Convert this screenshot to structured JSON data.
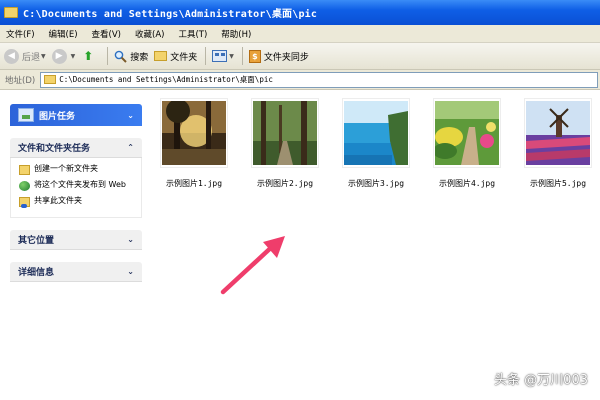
{
  "window": {
    "title": "C:\\Documents and Settings\\Administrator\\桌面\\pic"
  },
  "menu": [
    "文件(F)",
    "编辑(E)",
    "查看(V)",
    "收藏(A)",
    "工具(T)",
    "帮助(H)"
  ],
  "toolbar": {
    "back_label": "后退",
    "search_label": "搜索",
    "folders_label": "文件夹",
    "sync_label": "文件夹同步"
  },
  "address": {
    "label": "地址(D)",
    "value": "C:\\Documents and Settings\\Administrator\\桌面\\pic"
  },
  "sidebar": {
    "picture_tasks": "图片任务",
    "file_tasks": {
      "title": "文件和文件夹任务",
      "items": [
        "创建一个新文件夹",
        "将这个文件夹发布到 Web",
        "共享此文件夹"
      ]
    },
    "other_places": "其它位置",
    "details": "详细信息"
  },
  "files": [
    {
      "name": "示例图片1.jpg",
      "icon": "forest-sunlight-thumbnail"
    },
    {
      "name": "示例图片2.jpg",
      "icon": "forest-path-thumbnail"
    },
    {
      "name": "示例图片3.jpg",
      "icon": "sea-cliff-thumbnail"
    },
    {
      "name": "示例图片4.jpg",
      "icon": "garden-flowers-thumbnail"
    },
    {
      "name": "示例图片5.jpg",
      "icon": "tulip-windmill-thumbnail"
    }
  ],
  "annotation": {
    "arrow_color": "#ef3d6b"
  },
  "watermark": "头条 @万川003",
  "colors": {
    "titlebar": "#0a4fd4",
    "task_header": "#2c63d9",
    "menubar": "#ece9d8"
  }
}
